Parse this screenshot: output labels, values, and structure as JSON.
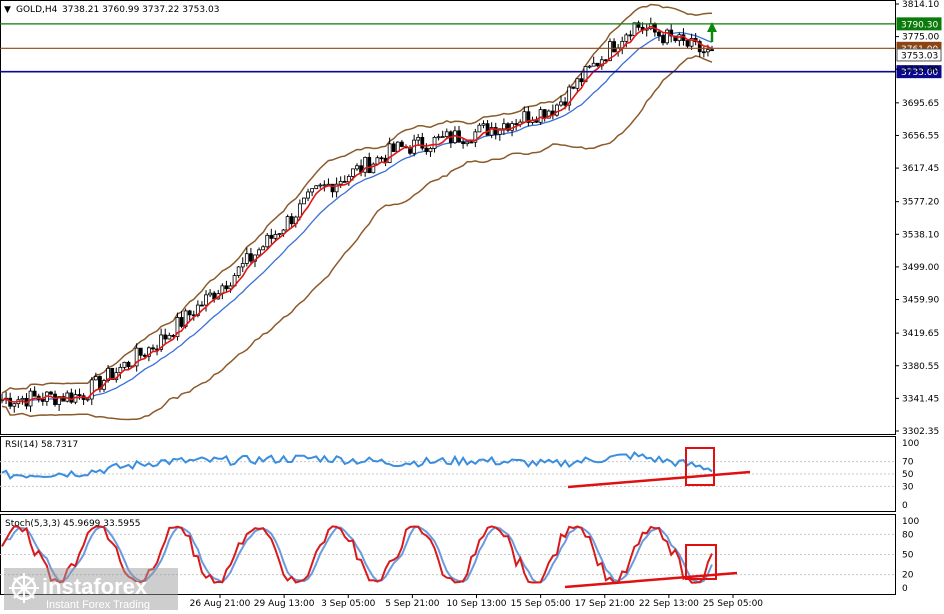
{
  "header": {
    "symbol": "GOLD,H4",
    "ohlc": "3738.21 3760.99 3737.22 3753.03"
  },
  "price_axis_ticks": [
    "3814.10",
    "3775.00",
    "3735.90",
    "3695.65",
    "3656.55",
    "3617.45",
    "3577.20",
    "3538.10",
    "3499.00",
    "3459.90",
    "3419.65",
    "3380.55",
    "3341.45",
    "3302.35"
  ],
  "price_levels": [
    {
      "value": 3790.3,
      "label": "3790.30",
      "color": "#0a7a0a"
    },
    {
      "value": 3761.0,
      "label": "3761.00",
      "color": "#8b4513"
    },
    {
      "value": 3753.03,
      "label": "3753.03",
      "color": "#555555"
    },
    {
      "value": 3733.0,
      "label": "3733.00",
      "color": "#0a0a8c"
    }
  ],
  "rsi": {
    "label": "RSI(14) 58.7317",
    "ticks": [
      "100",
      "70",
      "50",
      "30",
      "0"
    ]
  },
  "stoch": {
    "label": "Stoch(5,3,3) 45.9699 33.5955",
    "ticks": [
      "100",
      "80",
      "50",
      "20",
      "0"
    ]
  },
  "time_axis": [
    "26 Aug 21:00",
    "29 Aug 13:00",
    "3 Sep 05:00",
    "5 Sep 21:00",
    "10 Sep 13:00",
    "15 Sep 05:00",
    "17 Sep 21:00",
    "22 Sep 13:00",
    "25 Sep 05:00"
  ],
  "watermark": {
    "brand": "instaforex",
    "tagline": "Instant Forex Trading"
  },
  "colors": {
    "candle": "#000000",
    "ma_fast": "#e31515",
    "ma_slow": "#3a6fd8",
    "bollinger": "#8b5a2b",
    "rsi_line": "#3a8ee0",
    "stoch_main": "#d81a1a",
    "stoch_signal": "#6a9ae0",
    "annotation": "#e01010",
    "arrow": "#0a8a0a"
  },
  "chart_data": [
    {
      "type": "line",
      "title": "GOLD,H4",
      "description": "Candlestick price chart with moving averages and Bollinger Bands",
      "ylim": [
        3302.35,
        3814.1
      ],
      "x": [
        "26 Aug 21:00",
        "29 Aug 13:00",
        "3 Sep 05:00",
        "5 Sep 21:00",
        "10 Sep 13:00",
        "15 Sep 05:00",
        "17 Sep 21:00",
        "22 Sep 13:00",
        "25 Sep 05:00"
      ],
      "series": [
        {
          "name": "Close",
          "values": [
            3340,
            3345,
            3410,
            3495,
            3590,
            3640,
            3660,
            3690,
            3790,
            3753
          ]
        }
      ]
    },
    {
      "type": "line",
      "title": "RSI(14) 58.7317",
      "ylim": [
        0,
        100
      ],
      "series": [
        {
          "name": "RSI(14)",
          "values": [
            48,
            52,
            70,
            72,
            76,
            68,
            72,
            66,
            80,
            58.73
          ]
        }
      ]
    },
    {
      "type": "line",
      "title": "Stoch(5,3,3) 45.9699 33.5955",
      "ylim": [
        0,
        100
      ],
      "series": [
        {
          "name": "Main",
          "values": [
            60,
            85,
            40,
            90,
            30,
            80,
            10,
            95,
            20,
            45.97
          ]
        },
        {
          "name": "Signal",
          "values": [
            55,
            75,
            50,
            80,
            40,
            70,
            15,
            90,
            30,
            33.6
          ]
        }
      ]
    }
  ]
}
